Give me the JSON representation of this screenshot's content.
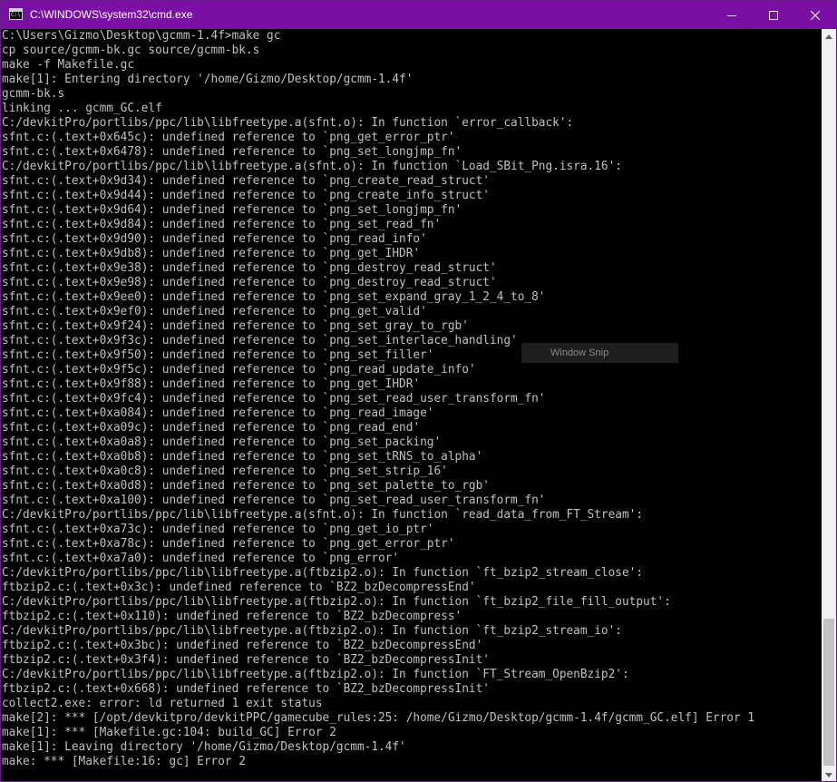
{
  "window": {
    "title": "C:\\WINDOWS\\system32\\cmd.exe",
    "icon": "cmd-icon",
    "icon_text": "C:\\",
    "title_color": "#7a0fa3"
  },
  "controls": {
    "minimize": "minimize-icon",
    "maximize": "maximize-icon",
    "close": "close-icon"
  },
  "overlay": {
    "label": "Window Snip"
  },
  "console": {
    "text_color": "#c0c0c0",
    "background": "#000000",
    "lines": [
      "C:\\Users\\Gizmo\\Desktop\\gcmm-1.4f>make gc",
      "cp source/gcmm-bk.gc source/gcmm-bk.s",
      "make -f Makefile.gc",
      "make[1]: Entering directory '/home/Gizmo/Desktop/gcmm-1.4f'",
      "gcmm-bk.s",
      "linking ... gcmm_GC.elf",
      "C:/devkitPro/portlibs/ppc/lib\\libfreetype.a(sfnt.o): In function `error_callback':",
      "sfnt.c:(.text+0x645c): undefined reference to `png_get_error_ptr'",
      "sfnt.c:(.text+0x6478): undefined reference to `png_set_longjmp_fn'",
      "C:/devkitPro/portlibs/ppc/lib\\libfreetype.a(sfnt.o): In function `Load_SBit_Png.isra.16':",
      "sfnt.c:(.text+0x9d34): undefined reference to `png_create_read_struct'",
      "sfnt.c:(.text+0x9d44): undefined reference to `png_create_info_struct'",
      "sfnt.c:(.text+0x9d64): undefined reference to `png_set_longjmp_fn'",
      "sfnt.c:(.text+0x9d84): undefined reference to `png_set_read_fn'",
      "sfnt.c:(.text+0x9d90): undefined reference to `png_read_info'",
      "sfnt.c:(.text+0x9db8): undefined reference to `png_get_IHDR'",
      "sfnt.c:(.text+0x9e38): undefined reference to `png_destroy_read_struct'",
      "sfnt.c:(.text+0x9e98): undefined reference to `png_destroy_read_struct'",
      "sfnt.c:(.text+0x9ee0): undefined reference to `png_set_expand_gray_1_2_4_to_8'",
      "sfnt.c:(.text+0x9ef0): undefined reference to `png_get_valid'",
      "sfnt.c:(.text+0x9f24): undefined reference to `png_set_gray_to_rgb'",
      "sfnt.c:(.text+0x9f3c): undefined reference to `png_set_interlace_handling'",
      "sfnt.c:(.text+0x9f50): undefined reference to `png_set_filler'",
      "sfnt.c:(.text+0x9f5c): undefined reference to `png_read_update_info'",
      "sfnt.c:(.text+0x9f88): undefined reference to `png_get_IHDR'",
      "sfnt.c:(.text+0x9fc4): undefined reference to `png_set_read_user_transform_fn'",
      "sfnt.c:(.text+0xa084): undefined reference to `png_read_image'",
      "sfnt.c:(.text+0xa09c): undefined reference to `png_read_end'",
      "sfnt.c:(.text+0xa0a8): undefined reference to `png_set_packing'",
      "sfnt.c:(.text+0xa0b8): undefined reference to `png_set_tRNS_to_alpha'",
      "sfnt.c:(.text+0xa0c8): undefined reference to `png_set_strip_16'",
      "sfnt.c:(.text+0xa0d8): undefined reference to `png_set_palette_to_rgb'",
      "sfnt.c:(.text+0xa100): undefined reference to `png_set_read_user_transform_fn'",
      "C:/devkitPro/portlibs/ppc/lib\\libfreetype.a(sfnt.o): In function `read_data_from_FT_Stream':",
      "sfnt.c:(.text+0xa73c): undefined reference to `png_get_io_ptr'",
      "sfnt.c:(.text+0xa78c): undefined reference to `png_get_error_ptr'",
      "sfnt.c:(.text+0xa7a0): undefined reference to `png_error'",
      "C:/devkitPro/portlibs/ppc/lib\\libfreetype.a(ftbzip2.o): In function `ft_bzip2_stream_close':",
      "ftbzip2.c:(.text+0x3c): undefined reference to `BZ2_bzDecompressEnd'",
      "C:/devkitPro/portlibs/ppc/lib\\libfreetype.a(ftbzip2.o): In function `ft_bzip2_file_fill_output':",
      "ftbzip2.c:(.text+0x110): undefined reference to `BZ2_bzDecompress'",
      "C:/devkitPro/portlibs/ppc/lib\\libfreetype.a(ftbzip2.o): In function `ft_bzip2_stream_io':",
      "ftbzip2.c:(.text+0x3bc): undefined reference to `BZ2_bzDecompressEnd'",
      "ftbzip2.c:(.text+0x3f4): undefined reference to `BZ2_bzDecompressInit'",
      "C:/devkitPro/portlibs/ppc/lib\\libfreetype.a(ftbzip2.o): In function `FT_Stream_OpenBzip2':",
      "ftbzip2.c:(.text+0x668): undefined reference to `BZ2_bzDecompressInit'",
      "collect2.exe: error: ld returned 1 exit status",
      "make[2]: *** [/opt/devkitpro/devkitPPC/gamecube_rules:25: /home/Gizmo/Desktop/gcmm-1.4f/gcmm_GC.elf] Error 1",
      "make[1]: *** [Makefile.gc:104: build_GC] Error 2",
      "make[1]: Leaving directory '/home/Gizmo/Desktop/gcmm-1.4f'",
      "make: *** [Makefile:16: gc] Error 2"
    ]
  },
  "scrollbar": {
    "up": "scroll-up-arrow-icon",
    "down": "scroll-down-arrow-icon"
  }
}
